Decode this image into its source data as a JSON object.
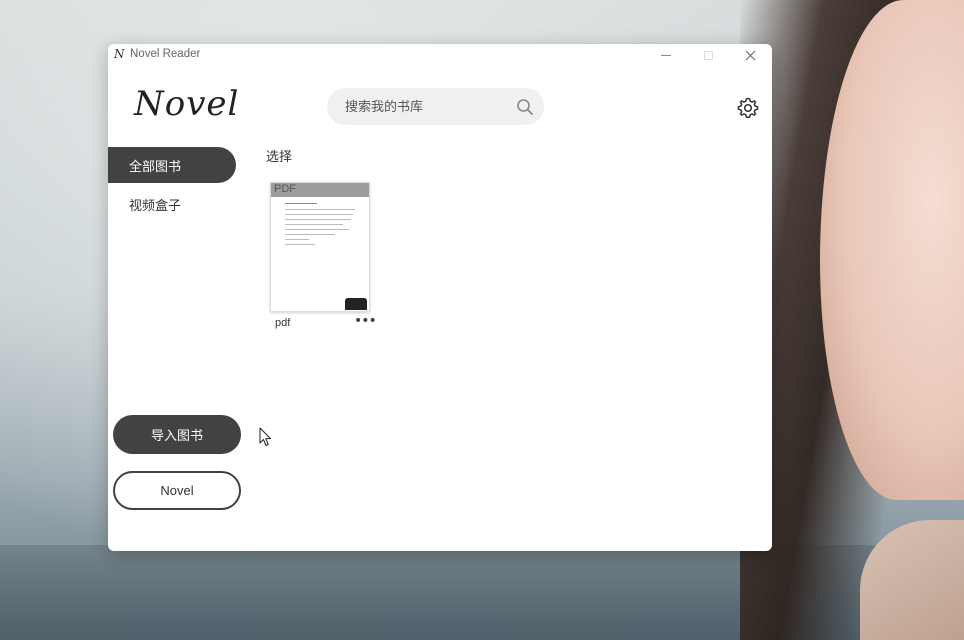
{
  "window": {
    "title": "Novel Reader",
    "app_icon": "N"
  },
  "header": {
    "logo": "Novel",
    "search_placeholder": "搜索我的书库"
  },
  "sidebar": {
    "items": [
      {
        "label": "全部图书",
        "active": true
      },
      {
        "label": "视频盒子",
        "active": false
      }
    ],
    "import_label": "导入图书",
    "novel_label": "Novel"
  },
  "main": {
    "section_label": "选择",
    "books": [
      {
        "title": "pdf",
        "cover_label": "PDF",
        "more": "•••"
      }
    ]
  },
  "colors": {
    "accent": "#424242",
    "search_bg": "#f0f0f0"
  },
  "icons": [
    "app-icon",
    "minimize-icon",
    "maximize-icon",
    "close-icon",
    "search-icon",
    "gear-icon",
    "more-icon",
    "mouse-cursor-icon"
  ]
}
